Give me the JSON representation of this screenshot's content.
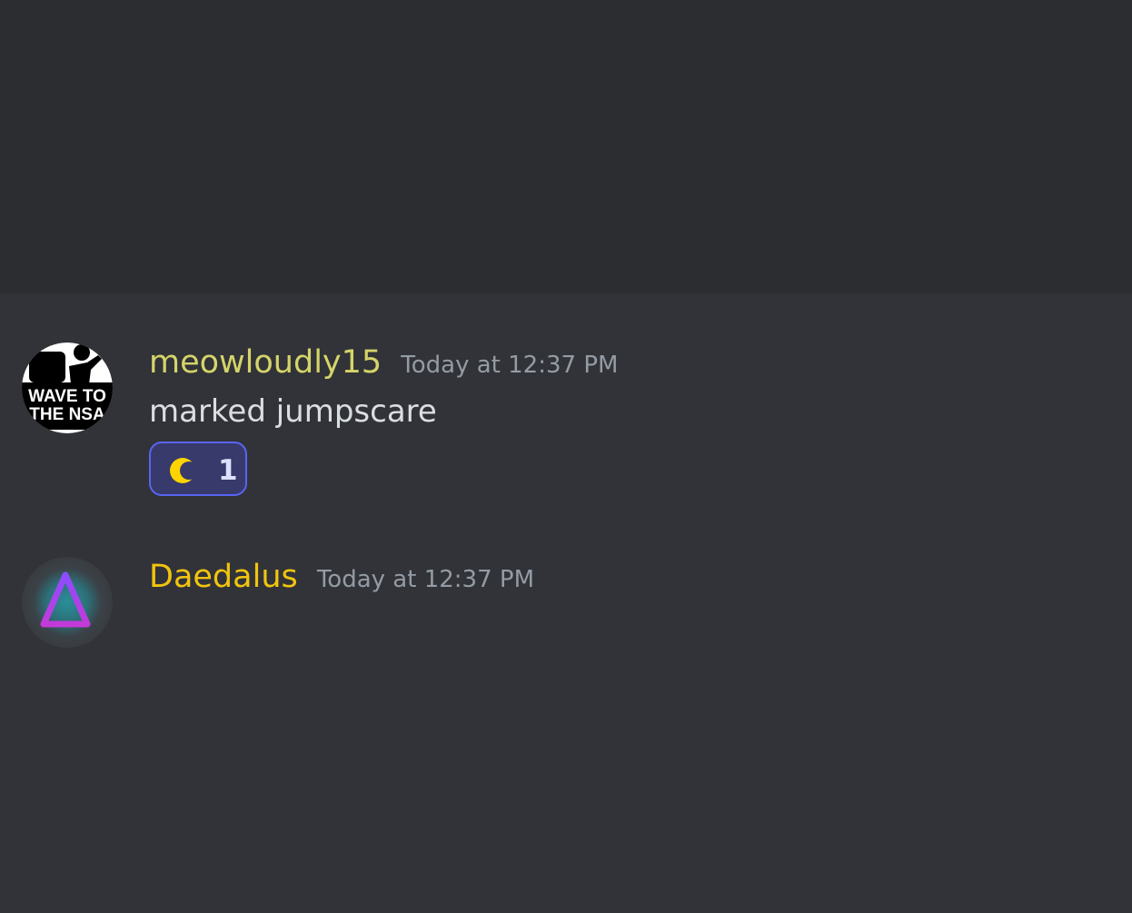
{
  "messages": [
    {
      "username": "meowloudly15",
      "username_color": "#d5d46a",
      "timestamp": "Today at 12:37 PM",
      "content": "marked jumpscare",
      "avatar": {
        "icon": "wave-to-the-nsa-avatar",
        "lines": [
          "WAVE TO",
          "THE NSA"
        ]
      },
      "reaction": {
        "emoji": "crescent-moon",
        "count": "1"
      }
    },
    {
      "username": "Daedalus",
      "username_color": "#f1c40f",
      "timestamp": "Today at 12:37 PM",
      "avatar": {
        "icon": "purple-triangle-avatar"
      }
    }
  ]
}
